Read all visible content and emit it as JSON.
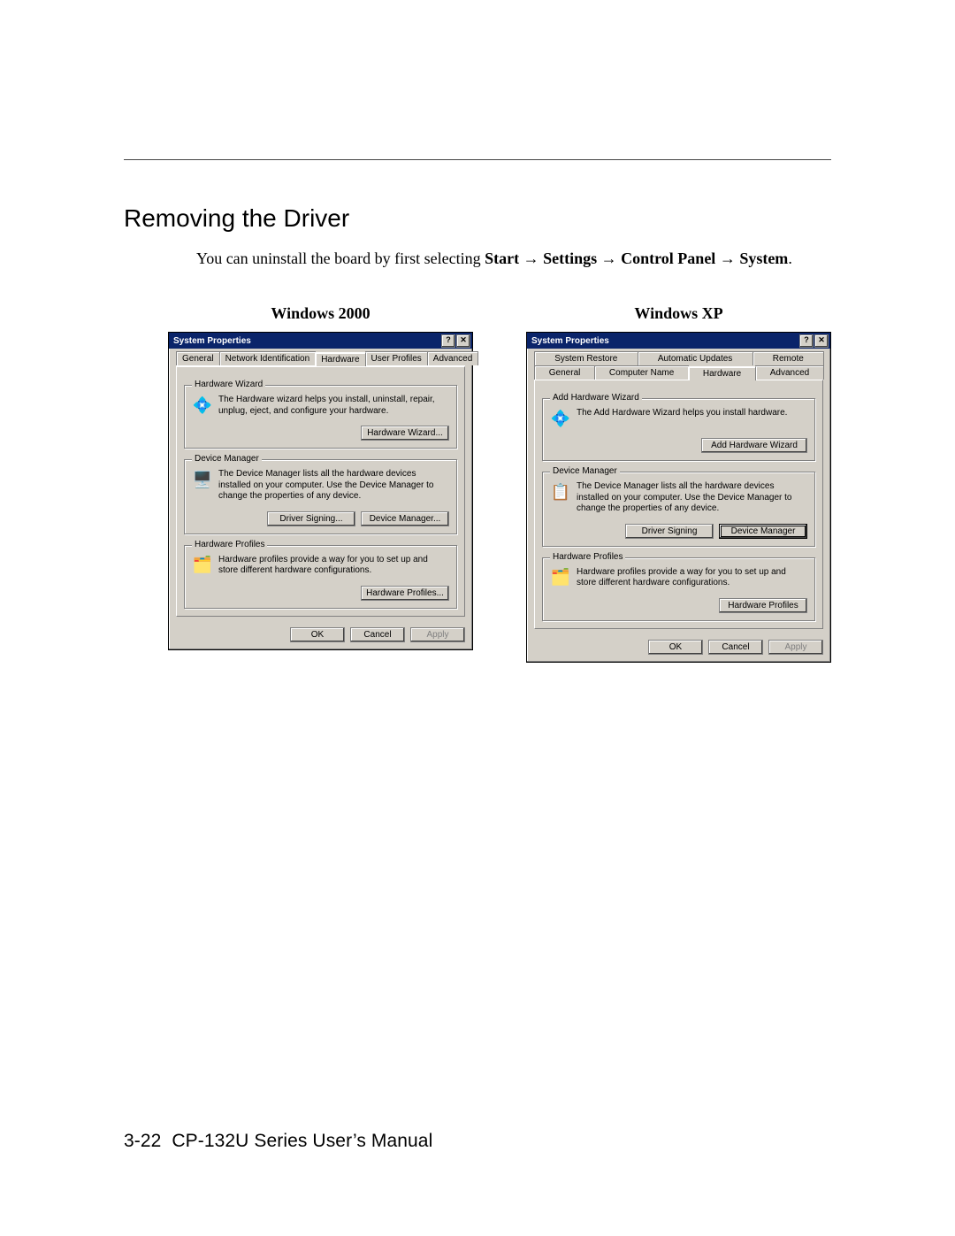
{
  "section_title": "Removing the Driver",
  "intro": {
    "before": "You can uninstall the board by first selecting ",
    "nav1": "Start",
    "arrow": " → ",
    "nav2": "Settings",
    "nav3": "Control Panel",
    "nav4": "System",
    "period": "."
  },
  "labels": {
    "left_os": "Windows 2000",
    "right_os": "Windows XP"
  },
  "footer": {
    "page_num": "3-22",
    "manual": "CP-132U Series User’s Manual"
  },
  "dlg2000": {
    "title": "System Properties",
    "tabs": [
      "General",
      "Network Identification",
      "Hardware",
      "User Profiles",
      "Advanced"
    ],
    "active_tab_index": 2,
    "hw_wizard": {
      "label": "Hardware Wizard",
      "text": "The Hardware wizard helps you install, uninstall, repair, unplug, eject, and configure your hardware.",
      "btn": "Hardware Wizard..."
    },
    "dev_mgr": {
      "label": "Device Manager",
      "text": "The Device Manager lists all the hardware devices installed on your computer. Use the Device Manager to change the properties of any device.",
      "btn_sign": "Driver Signing...",
      "btn_dm": "Device Manager..."
    },
    "hw_prof": {
      "label": "Hardware Profiles",
      "text": "Hardware profiles provide a way for you to set up and store different hardware configurations.",
      "btn": "Hardware Profiles..."
    },
    "ok": "OK",
    "cancel": "Cancel",
    "apply": "Apply"
  },
  "dlgxp": {
    "title": "System Properties",
    "tabs_row1": [
      "System Restore",
      "Automatic Updates",
      "Remote"
    ],
    "tabs_row2": [
      "General",
      "Computer Name",
      "Hardware",
      "Advanced"
    ],
    "active_tab_index": 2,
    "add_hw": {
      "label": "Add Hardware Wizard",
      "text": "The Add Hardware Wizard helps you install hardware.",
      "btn": "Add Hardware Wizard"
    },
    "dev_mgr": {
      "label": "Device Manager",
      "text": "The Device Manager lists all the hardware devices installed on your computer. Use the Device Manager to change the properties of any device.",
      "btn_sign": "Driver Signing",
      "btn_dm": "Device Manager"
    },
    "hw_prof": {
      "label": "Hardware Profiles",
      "text": "Hardware profiles provide a way for you to set up and store different hardware configurations.",
      "btn": "Hardware Profiles"
    },
    "ok": "OK",
    "cancel": "Cancel",
    "apply": "Apply"
  }
}
